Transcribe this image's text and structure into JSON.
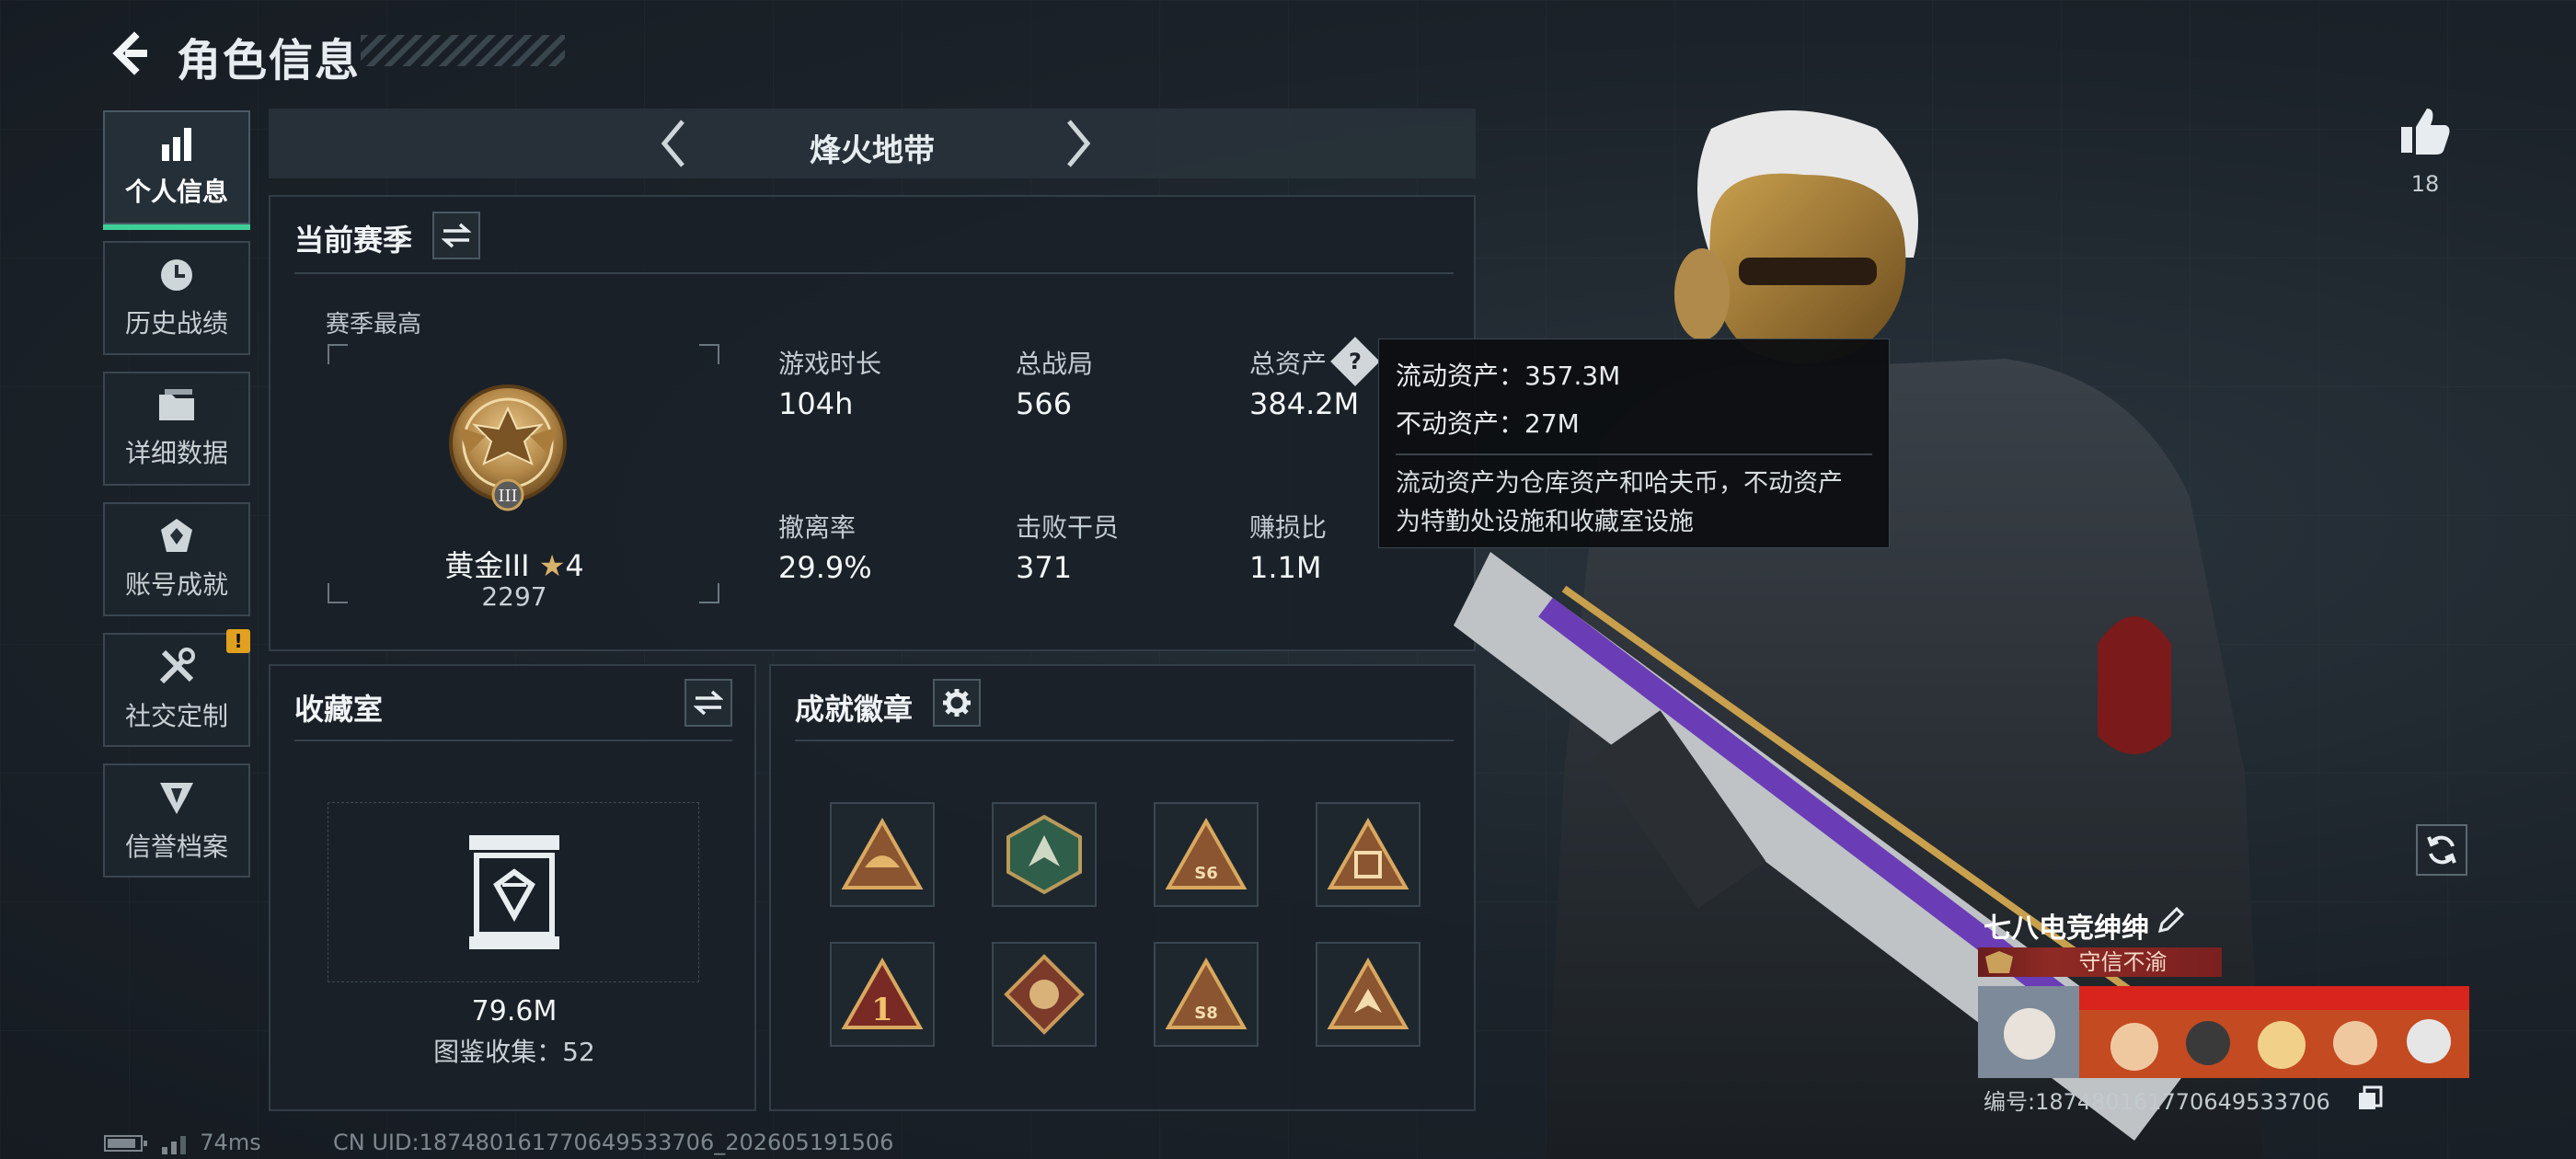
{
  "header": {
    "title": "角色信息"
  },
  "sidebar": {
    "items": [
      {
        "label": "个人信息",
        "icon": "bar-chart-icon",
        "active": true
      },
      {
        "label": "历史战绩",
        "icon": "history-clock-icon"
      },
      {
        "label": "详细数据",
        "icon": "folder-icon"
      },
      {
        "label": "账号成就",
        "icon": "achievement-icon"
      },
      {
        "label": "社交定制",
        "icon": "tools-icon",
        "badge": "!"
      },
      {
        "label": "信誉档案",
        "icon": "credit-icon"
      }
    ]
  },
  "mode_selector": {
    "current": "烽火地带"
  },
  "season": {
    "title": "当前赛季",
    "best_label": "赛季最高",
    "rank_name": "黄金III",
    "rank_stars": "4",
    "rank_score": "2297",
    "stats": [
      {
        "label": "游戏时长",
        "value": "104h"
      },
      {
        "label": "总战局",
        "value": "566"
      },
      {
        "label": "总资产",
        "value": "384.2M"
      },
      {
        "label": "撤离率",
        "value": "29.9%"
      },
      {
        "label": "击败干员",
        "value": "371"
      },
      {
        "label": "赚损比",
        "value": "1.1M"
      }
    ]
  },
  "tooltip": {
    "liquid": "流动资产：357.3M",
    "fixed": "不动资产：27M",
    "desc_line1": "流动资产为仓库资产和哈夫币，不动资产",
    "desc_line2": "为特勤处设施和收藏室设施"
  },
  "collection": {
    "title": "收藏室",
    "value": "79.6M",
    "caption": "图鉴收集：52"
  },
  "achievements": {
    "title": "成就徽章",
    "badges": [
      {
        "icon": "helmet-triangle-badge-icon"
      },
      {
        "icon": "dragon-hexagon-badge-icon"
      },
      {
        "icon": "s6-triangle-badge-icon",
        "text": "S6"
      },
      {
        "icon": "frame-triangle-badge-icon"
      },
      {
        "icon": "number-one-triangle-badge-icon",
        "text": "1"
      },
      {
        "icon": "beast-diamond-badge-icon"
      },
      {
        "icon": "s8-triangle-badge-icon",
        "text": "S8"
      },
      {
        "icon": "crest-triangle-badge-icon"
      }
    ]
  },
  "like": {
    "count": "18"
  },
  "player": {
    "name": "七八电竞绅绅",
    "title": "守信不渝",
    "id_line": "编号:187480161770649533706"
  },
  "footer": {
    "ping": "74ms",
    "uid": "CN UID:187480161770649533706_202605191506"
  },
  "colors": {
    "accent": "#3ecf97",
    "gold": "#c9a15a",
    "warning": "#e0a020",
    "title_plate": "#8e2a24"
  }
}
